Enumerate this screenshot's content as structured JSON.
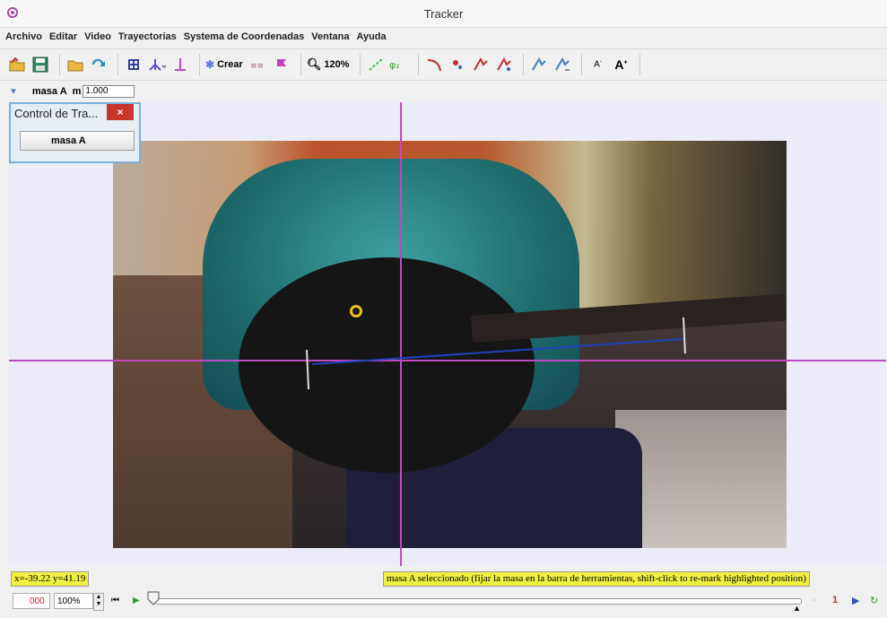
{
  "window": {
    "title": "Tracker"
  },
  "menu": [
    "Archivo",
    "Editar",
    "Video",
    "Trayectorias",
    "Systema de Coordenadas",
    "Ventana",
    "Ayuda"
  ],
  "toolbar": {
    "create_label": "Crear",
    "zoom_label": "120%",
    "icons": [
      "open-folder-icon",
      "save-icon",
      "open-video-icon",
      "refresh-icon",
      "clip-settings-icon",
      "axes-icon",
      "calibration-icon",
      "new-track-icon",
      "hint-icon",
      "points-icon",
      "zoom-icon",
      "line-icon",
      "angle-icon",
      "arc-icon",
      "point-icon",
      "trail-icon",
      "trail2-icon",
      "mark-icon",
      "mark2-icon",
      "font-smaller-icon",
      "font-larger-icon"
    ]
  },
  "trackbar": {
    "track_name": "masa A",
    "mass_label": "m",
    "mass_value": "1.000"
  },
  "panel": {
    "title": "Control de Tra...",
    "close": "×",
    "track_button": "masa A"
  },
  "status": {
    "coords": "x=-39.22  y=41.19",
    "message": "masa A seleccionado (fijar la masa en la barra de herramientas, shift-click to re-mark highlighted position)"
  },
  "player": {
    "frame": "000",
    "zoom": "100%"
  },
  "colors": {
    "axes": "#c048c0",
    "tape": "#2040c0",
    "marker": "#f0c020",
    "status_bg": "#f0f040"
  }
}
